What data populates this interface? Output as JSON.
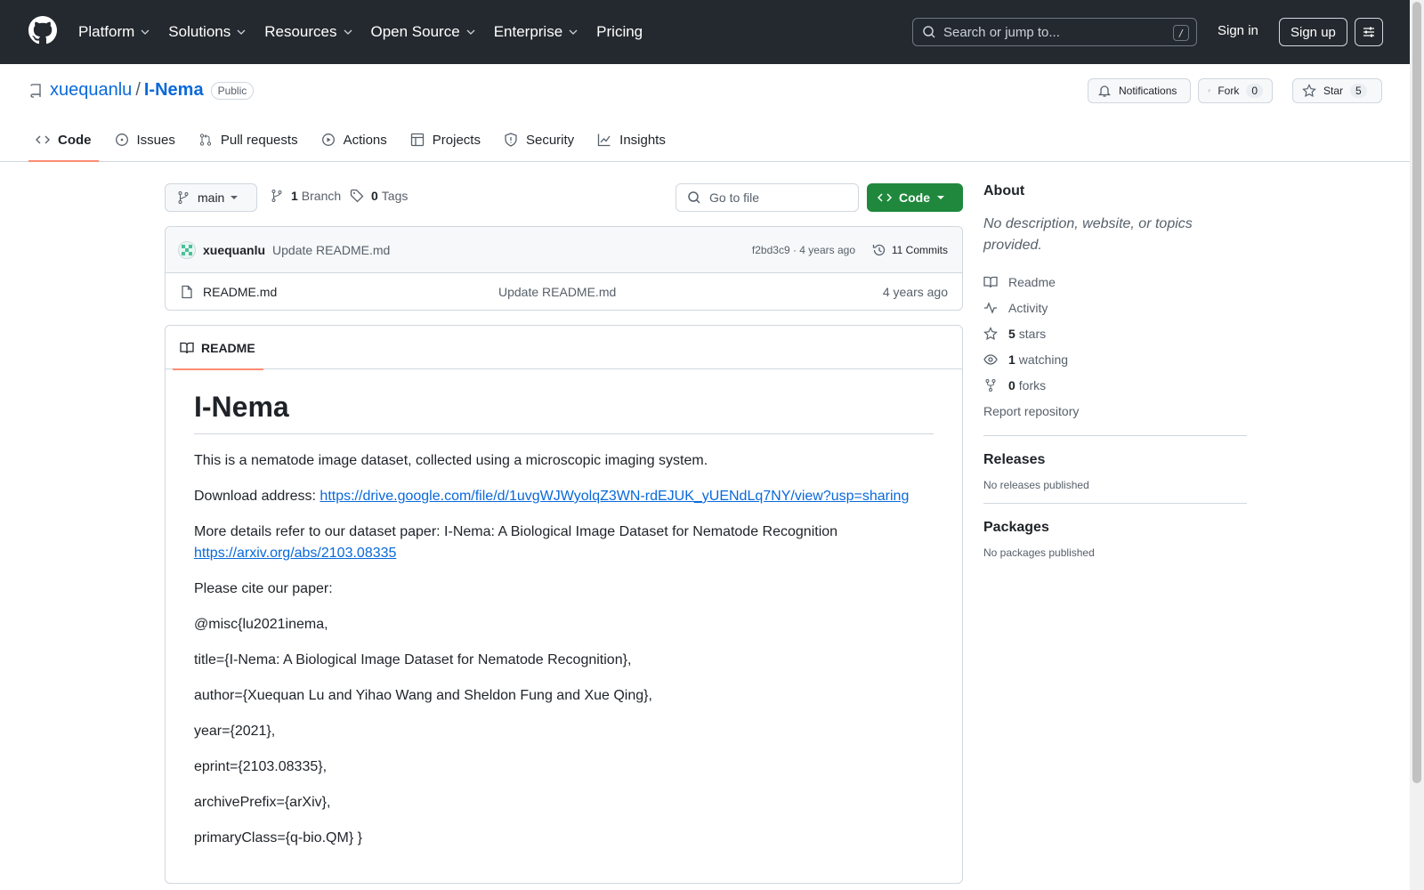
{
  "header": {
    "nav": [
      "Platform",
      "Solutions",
      "Resources",
      "Open Source",
      "Enterprise",
      "Pricing"
    ],
    "search_placeholder": "Search or jump to...",
    "search_shortcut": "/",
    "sign_in": "Sign in",
    "sign_up": "Sign up"
  },
  "repo": {
    "owner": "xuequanlu",
    "separator": "/",
    "name": "I-Nema",
    "visibility": "Public",
    "notifications_label": "Notifications",
    "fork_label": "Fork",
    "fork_count": "0",
    "star_label": "Star",
    "star_count": "5"
  },
  "tabs": [
    {
      "label": "Code",
      "icon": "code-icon",
      "active": true
    },
    {
      "label": "Issues",
      "icon": "issue-icon"
    },
    {
      "label": "Pull requests",
      "icon": "pull-request-icon"
    },
    {
      "label": "Actions",
      "icon": "play-icon"
    },
    {
      "label": "Projects",
      "icon": "table-icon"
    },
    {
      "label": "Security",
      "icon": "shield-icon"
    },
    {
      "label": "Insights",
      "icon": "graph-icon"
    }
  ],
  "toolbar": {
    "branch": "main",
    "branch_count": "1",
    "branch_label": "Branch",
    "tag_count": "0",
    "tag_label": "Tags",
    "goto_placeholder": "Go to file",
    "code_button": "Code"
  },
  "latest_commit": {
    "author": "xuequanlu",
    "message": "Update README.md",
    "meta": "f2bd3c9 · 4 years ago",
    "commits_label": "11 Commits"
  },
  "files": [
    {
      "name": "README.md",
      "message": "Update README.md",
      "time": "4 years ago",
      "icon": "file-icon"
    }
  ],
  "readme": {
    "tab_label": "README",
    "title": "I-Nema",
    "intro": "This is a nematode image dataset, collected using a microscopic imaging system.",
    "download_prefix": "Download address: ",
    "download_url": "https://drive.google.com/file/d/1uvgWJWyolqZ3WN-rdEJUK_yUENdLq7NY/view?usp=sharing",
    "details_text": "More details refer to our dataset paper: I-Nema: A Biological Image Dataset for Nematode Recognition",
    "arxiv_url": "https://arxiv.org/abs/2103.08335",
    "cite_intro": "Please cite our paper:",
    "cite_lines": [
      "@misc{lu2021inema,",
      "title={I-Nema: A Biological Image Dataset for Nematode Recognition},",
      "author={Xuequan Lu and Yihao Wang and Sheldon Fung and Xue Qing},",
      "year={2021},",
      "eprint={2103.08335},",
      "archivePrefix={arXiv},",
      "primaryClass={q-bio.QM} }"
    ]
  },
  "sidebar": {
    "about_title": "About",
    "about_desc": "No description, website, or topics provided.",
    "links": [
      {
        "icon": "book-icon",
        "strong": "",
        "text": "Readme"
      },
      {
        "icon": "pulse-icon",
        "strong": "",
        "text": "Activity"
      },
      {
        "icon": "star-icon",
        "strong": "5",
        "text": "stars"
      },
      {
        "icon": "eye-icon",
        "strong": "1",
        "text": "watching"
      },
      {
        "icon": "fork-icon",
        "strong": "0",
        "text": "forks"
      }
    ],
    "report": "Report repository",
    "releases_title": "Releases",
    "releases_note": "No releases published",
    "packages_title": "Packages",
    "packages_note": "No packages published"
  },
  "colors": {
    "header_bg": "#24292f",
    "link": "#0969da",
    "code_button": "#1f883d",
    "tab_underline": "#fd8c73"
  }
}
